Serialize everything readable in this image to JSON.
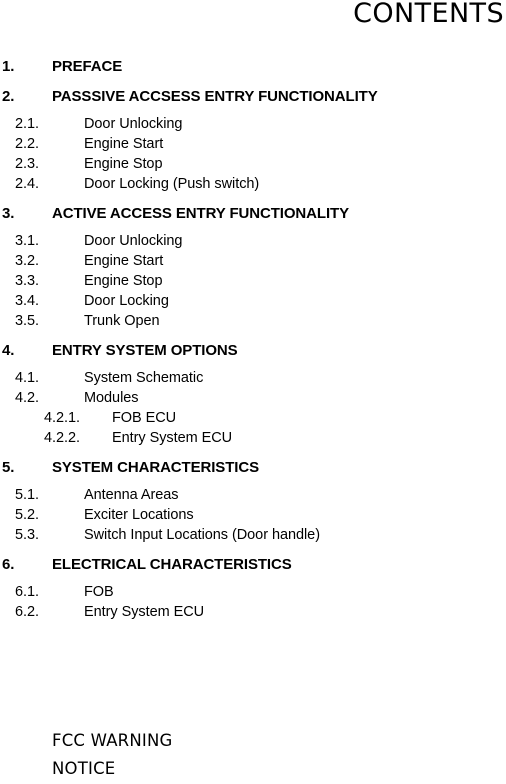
{
  "document": {
    "title": "CONTENTS"
  },
  "toc": {
    "groups": [
      {
        "heading": {
          "number": "1.",
          "text": "PREFACE"
        },
        "entries": []
      },
      {
        "heading": {
          "number": "2.",
          "text": "PASSSIVE ACCSESS ENTRY FUNCTIONALITY"
        },
        "entries": [
          {
            "level": 2,
            "number": "2.1.",
            "text": "Door Unlocking"
          },
          {
            "level": 2,
            "number": "2.2.",
            "text": "Engine Start"
          },
          {
            "level": 2,
            "number": "2.3.",
            "text": "Engine Stop"
          },
          {
            "level": 2,
            "number": "2.4.",
            "text": "Door Locking (Push switch)"
          }
        ]
      },
      {
        "heading": {
          "number": "3.",
          "text": "ACTIVE ACCESS ENTRY FUNCTIONALITY"
        },
        "entries": [
          {
            "level": 2,
            "number": "3.1.",
            "text": "Door Unlocking"
          },
          {
            "level": 2,
            "number": "3.2.",
            "text": "Engine Start"
          },
          {
            "level": 2,
            "number": "3.3.",
            "text": "Engine Stop"
          },
          {
            "level": 2,
            "number": "3.4.",
            "text": "Door Locking"
          },
          {
            "level": 2,
            "number": "3.5.",
            "text": "Trunk Open"
          }
        ]
      },
      {
        "heading": {
          "number": "4.",
          "text": "ENTRY SYSTEM OPTIONS"
        },
        "entries": [
          {
            "level": 2,
            "number": "4.1.",
            "text": "System Schematic"
          },
          {
            "level": 2,
            "number": "4.2.",
            "text": "Modules"
          },
          {
            "level": 3,
            "number": "4.2.1.",
            "text": "FOB ECU"
          },
          {
            "level": 3,
            "number": "4.2.2.",
            "text": "Entry System ECU"
          }
        ]
      },
      {
        "heading": {
          "number": "5.",
          "text": "SYSTEM CHARACTERISTICS"
        },
        "entries": [
          {
            "level": 2,
            "number": "5.1.",
            "text": "Antenna Areas"
          },
          {
            "level": 2,
            "number": "5.2.",
            "text": "Exciter Locations"
          },
          {
            "level": 2,
            "number": "5.3.",
            "text": "Switch Input Locations (Door handle)"
          }
        ]
      },
      {
        "heading": {
          "number": "6.",
          "text": "ELECTRICAL CHARACTERISTICS"
        },
        "entries": [
          {
            "level": 2,
            "number": "6.1.",
            "text": "FOB"
          },
          {
            "level": 2,
            "number": "6.2.",
            "text": "Entry System ECU"
          }
        ]
      }
    ]
  },
  "notices": {
    "lines": [
      "FCC WARNING",
      "NOTICE"
    ]
  }
}
